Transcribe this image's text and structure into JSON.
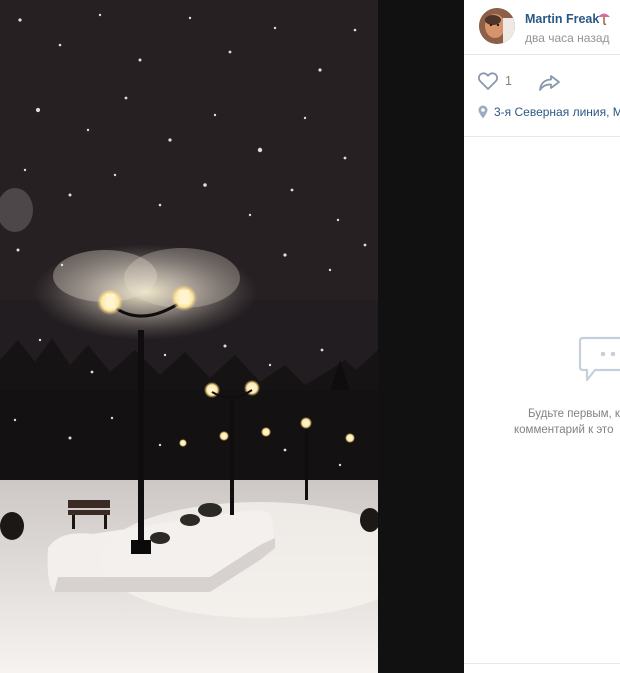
{
  "post": {
    "author": "Martin Freak",
    "author_emoji": "umbrella-icon",
    "time": "два часа назад",
    "likes": "1",
    "location": "3-я Северная линия, М"
  },
  "comments": {
    "empty_line1": "Будьте первым, к",
    "empty_line2": "комментарий к это"
  },
  "colors": {
    "panel": "#ffffff",
    "link": "#2a5885",
    "muted": "#828282",
    "border": "#e7e8ec",
    "viewer_bg": "#111111"
  }
}
